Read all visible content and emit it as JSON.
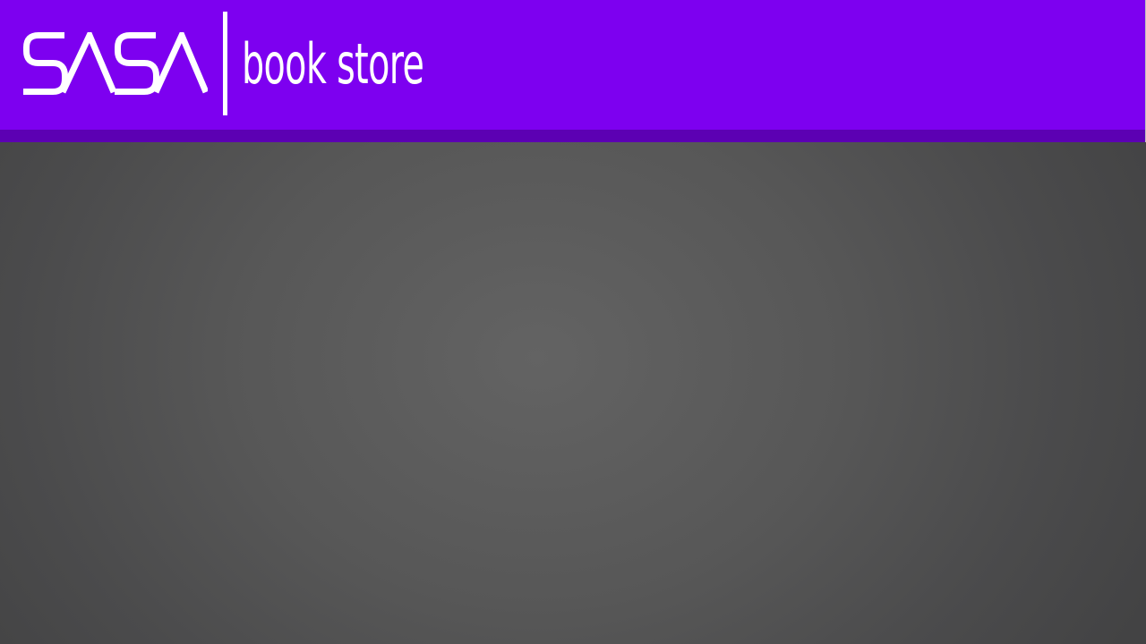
{
  "header": {
    "logo_text": "SASA",
    "store_name": "book store",
    "colors": {
      "header_background": "#7d00f0",
      "header_stripe": "#5c00b3",
      "logo_foreground": "#ffffff"
    }
  },
  "main": {
    "background_color": "#575757"
  }
}
